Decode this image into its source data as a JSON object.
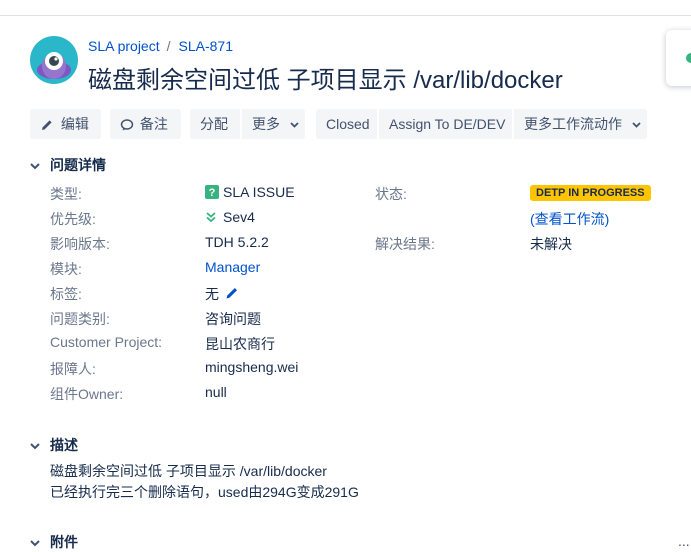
{
  "breadcrumb": {
    "project": "SLA project",
    "issue_key": "SLA-871"
  },
  "issue": {
    "title": "磁盘剩余空间过低 子项目显示 /var/lib/docker"
  },
  "toolbar": {
    "edit": "编辑",
    "comment": "备注",
    "assign": "分配",
    "more": "更多",
    "closed": "Closed",
    "assign_to": "Assign To DE/DEV",
    "more_workflow": "更多工作流动作"
  },
  "details": {
    "heading": "问题详情",
    "type_label": "类型:",
    "type_value": "SLA ISSUE",
    "priority_label": "优先级:",
    "priority_value": "Sev4",
    "affects_label": "影响版本:",
    "affects_value": "TDH 5.2.2",
    "component_label": "模块:",
    "component_value": "Manager",
    "labels_label": "标签:",
    "labels_value": "无",
    "category_label": "问题类别:",
    "category_value": "咨询问题",
    "customer_label": "Customer Project:",
    "customer_value": "昆山农商行",
    "reporter_label": "报障人:",
    "reporter_value": "mingsheng.wei",
    "owner_label": "组件Owner:",
    "owner_value": "null",
    "status_label": "状态:",
    "status_value": "DETP IN PROGRESS",
    "workflow_link": "(查看工作流)",
    "resolution_label": "解决结果:",
    "resolution_value": "未解决"
  },
  "description": {
    "heading": "描述",
    "line1": "磁盘剩余空间过低 子项目显示 /var/lib/docker",
    "line2": "已经执行完三个删除语句，used由294G变成291G"
  },
  "attachments": {
    "heading": "附件",
    "more": "..."
  },
  "colors": {
    "link": "#0052cc",
    "status_badge": "#ffc400",
    "avatar": "#2ab7c9"
  },
  "icons": [
    "pencil-icon",
    "comment-icon",
    "chevron-down-icon",
    "issue-type-icon",
    "priority-low-icon",
    "edit-labels-icon",
    "twisty-icon"
  ]
}
